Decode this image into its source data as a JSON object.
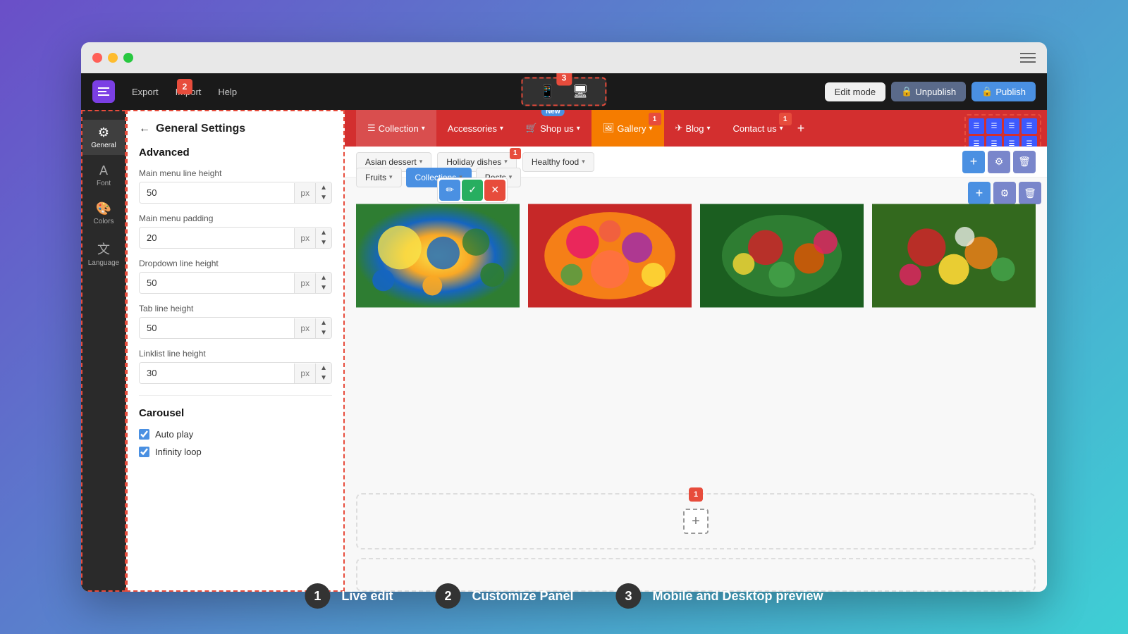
{
  "browser": {
    "dots": [
      "red",
      "yellow",
      "green"
    ]
  },
  "topbar": {
    "logo_label": "Menu",
    "nav_items": [
      "Export",
      "Import",
      "Help"
    ],
    "preview_modes": [
      "mobile",
      "desktop"
    ],
    "edit_mode_label": "Edit mode",
    "unpublish_label": "Unpublish",
    "publish_label": "Publish",
    "badge2": "2",
    "badge3": "3"
  },
  "sidebar": {
    "items": [
      {
        "label": "General",
        "icon": "⚙"
      },
      {
        "label": "Font",
        "icon": "A"
      },
      {
        "label": "Colors",
        "icon": "🎨"
      },
      {
        "label": "Language",
        "icon": "文"
      }
    ]
  },
  "panel": {
    "back_label": "←",
    "title": "General Settings",
    "section_advanced": "Advanced",
    "fields": [
      {
        "label": "Main menu line height",
        "value": "50",
        "unit": "px"
      },
      {
        "label": "Main menu padding",
        "value": "20",
        "unit": "px"
      },
      {
        "label": "Dropdown line height",
        "value": "50",
        "unit": "px"
      },
      {
        "label": "Tab line height",
        "value": "50",
        "unit": "px"
      },
      {
        "label": "Linklist line height",
        "value": "30",
        "unit": "px"
      }
    ],
    "section_carousel": "Carousel",
    "checkboxes": [
      {
        "label": "Auto play",
        "checked": true
      },
      {
        "label": "Infinity loop",
        "checked": true
      }
    ]
  },
  "site_nav": {
    "items": [
      {
        "label": "Collection",
        "has_chevron": true,
        "active": true
      },
      {
        "label": "Accessories",
        "has_chevron": true
      },
      {
        "label": "Shop us",
        "has_chevron": true,
        "new": true
      },
      {
        "label": "Gallery",
        "active_orange": true,
        "has_chevron": true
      },
      {
        "label": "Blog",
        "has_chevron": true
      },
      {
        "label": "Contact us",
        "has_chevron": true
      }
    ],
    "plus_label": "+",
    "badge1": "1"
  },
  "sub_nav": {
    "filters": [
      {
        "label": "Asian dessert",
        "has_chevron": true
      },
      {
        "label": "Holiday dishes",
        "has_chevron": true,
        "badge": "1"
      },
      {
        "label": "Healthy food",
        "has_chevron": true
      },
      {
        "label": "Fruits",
        "has_chevron": true
      },
      {
        "label": "Collections",
        "has_chevron": true,
        "active": true
      },
      {
        "label": "Posts",
        "has_chevron": true
      }
    ],
    "action_icons": [
      "✏",
      "✏",
      "🗑"
    ]
  },
  "images": [
    {
      "alt": "Fruit bowl 1",
      "style": "img-fruit1"
    },
    {
      "alt": "Fruit bowl 2",
      "style": "img-fruit2"
    },
    {
      "alt": "Fruit bowl 3",
      "style": "img-fruit3"
    },
    {
      "alt": "Fruit bowl 4",
      "style": "img-fruit4"
    }
  ],
  "legend": [
    {
      "num": "1",
      "text": "Live edit"
    },
    {
      "num": "2",
      "text": "Customize Panel"
    },
    {
      "num": "3",
      "text": "Mobile and Desktop preview"
    }
  ]
}
